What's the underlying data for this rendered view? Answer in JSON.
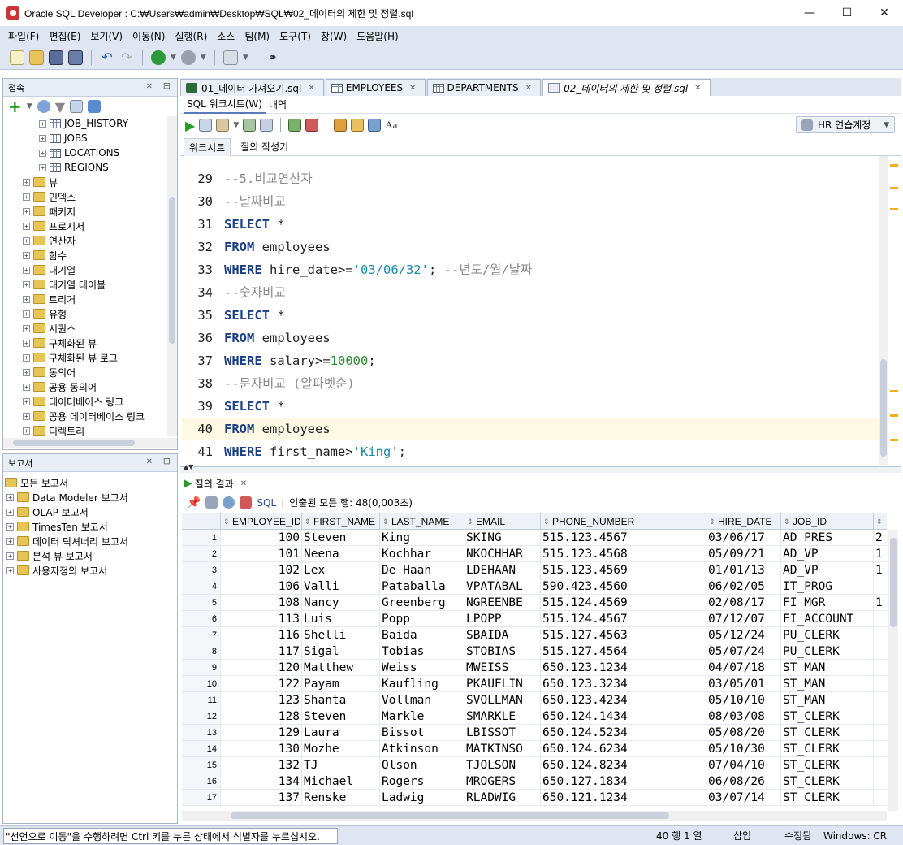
{
  "window": {
    "title": "Oracle SQL Developer : C:₩Users₩admin₩Desktop₩SQL₩02_데이터의 제한 및 정렬.sql"
  },
  "menu": [
    "파일(F)",
    "편집(E)",
    "보기(V)",
    "이동(N)",
    "실행(R)",
    "소스",
    "팀(M)",
    "도구(T)",
    "창(W)",
    "도움말(H)"
  ],
  "connections_panel": {
    "title": "접속",
    "items": [
      "JOB_HISTORY",
      "JOBS",
      "LOCATIONS",
      "REGIONS",
      "뷰",
      "인덱스",
      "패키지",
      "프로시저",
      "연산자",
      "함수",
      "대기열",
      "대기열 테이블",
      "트리거",
      "유형",
      "시퀀스",
      "구체화된 뷰",
      "구체화된 뷰 로그",
      "동의어",
      "공용 동의어",
      "데이터베이스 링크",
      "공용 데이터베이스 링크",
      "디렉토리"
    ]
  },
  "reports_panel": {
    "title": "보고서",
    "items": [
      "모든 보고서",
      "Data Modeler 보고서",
      "OLAP 보고서",
      "TimesTen 보고서",
      "데이터 딕셔너리 보고서",
      "분석 뷰 보고서",
      "사용자정의 보고서"
    ]
  },
  "editor_tabs": [
    "01_데이터 가져오기.sql",
    "EMPLOYEES",
    "DEPARTMENTS",
    "02_데이터의 제한 및 정렬.sql"
  ],
  "sub_tabs": {
    "worksheet": "SQL 워크시트(W)",
    "history": "내역"
  },
  "connection": "HR 연습계정",
  "worksheet_tabs": {
    "worksheet": "워크시트",
    "query_builder": "질의 작성기"
  },
  "code": [
    {
      "n": "29",
      "t": "--5.비교연산자"
    },
    {
      "n": "30",
      "t": "--날짜비교"
    },
    {
      "n": "31",
      "t": "SELECT *"
    },
    {
      "n": "32",
      "t": "FROM employees"
    },
    {
      "n": "33",
      "t": "WHERE hire_date>='03/06/32'; --년도/월/날짜"
    },
    {
      "n": "34",
      "t": "--숫자비교"
    },
    {
      "n": "35",
      "t": "SELECT *"
    },
    {
      "n": "36",
      "t": "FROM employees"
    },
    {
      "n": "37",
      "t": "WHERE salary>=10000;"
    },
    {
      "n": "38",
      "t": "--문자비교 (알파벳순)"
    },
    {
      "n": "39",
      "t": "SELECT *"
    },
    {
      "n": "40",
      "t": "FROM employees"
    },
    {
      "n": "41",
      "t": "WHERE first_name>'King';"
    }
  ],
  "result": {
    "tab": "질의 결과",
    "sql_label": "SQL",
    "status": "인출된 모든 행: 48(0,003초)",
    "columns": [
      "EMPLOYEE_ID",
      "FIRST_NAME",
      "LAST_NAME",
      "EMAIL",
      "PHONE_NUMBER",
      "HIRE_DATE",
      "JOB_ID",
      ""
    ],
    "rows": [
      [
        "1",
        "100",
        "Steven",
        "King",
        "SKING",
        "515.123.4567",
        "03/06/17",
        "AD_PRES",
        "2"
      ],
      [
        "2",
        "101",
        "Neena",
        "Kochhar",
        "NKOCHHAR",
        "515.123.4568",
        "05/09/21",
        "AD_VP",
        "1"
      ],
      [
        "3",
        "102",
        "Lex",
        "De Haan",
        "LDEHAAN",
        "515.123.4569",
        "01/01/13",
        "AD_VP",
        "1"
      ],
      [
        "4",
        "106",
        "Valli",
        "Pataballa",
        "VPATABAL",
        "590.423.4560",
        "06/02/05",
        "IT_PROG",
        ""
      ],
      [
        "5",
        "108",
        "Nancy",
        "Greenberg",
        "NGREENBE",
        "515.124.4569",
        "02/08/17",
        "FI_MGR",
        "1"
      ],
      [
        "6",
        "113",
        "Luis",
        "Popp",
        "LPOPP",
        "515.124.4567",
        "07/12/07",
        "FI_ACCOUNT",
        ""
      ],
      [
        "7",
        "116",
        "Shelli",
        "Baida",
        "SBAIDA",
        "515.127.4563",
        "05/12/24",
        "PU_CLERK",
        ""
      ],
      [
        "8",
        "117",
        "Sigal",
        "Tobias",
        "STOBIAS",
        "515.127.4564",
        "05/07/24",
        "PU_CLERK",
        ""
      ],
      [
        "9",
        "120",
        "Matthew",
        "Weiss",
        "MWEISS",
        "650.123.1234",
        "04/07/18",
        "ST_MAN",
        ""
      ],
      [
        "10",
        "122",
        "Payam",
        "Kaufling",
        "PKAUFLIN",
        "650.123.3234",
        "03/05/01",
        "ST_MAN",
        ""
      ],
      [
        "11",
        "123",
        "Shanta",
        "Vollman",
        "SVOLLMAN",
        "650.123.4234",
        "05/10/10",
        "ST_MAN",
        ""
      ],
      [
        "12",
        "128",
        "Steven",
        "Markle",
        "SMARKLE",
        "650.124.1434",
        "08/03/08",
        "ST_CLERK",
        ""
      ],
      [
        "13",
        "129",
        "Laura",
        "Bissot",
        "LBISSOT",
        "650.124.5234",
        "05/08/20",
        "ST_CLERK",
        ""
      ],
      [
        "14",
        "130",
        "Mozhe",
        "Atkinson",
        "MATKINSO",
        "650.124.6234",
        "05/10/30",
        "ST_CLERK",
        ""
      ],
      [
        "15",
        "132",
        "TJ",
        "Olson",
        "TJOLSON",
        "650.124.8234",
        "07/04/10",
        "ST_CLERK",
        ""
      ],
      [
        "16",
        "134",
        "Michael",
        "Rogers",
        "MROGERS",
        "650.127.1834",
        "06/08/26",
        "ST_CLERK",
        ""
      ],
      [
        "17",
        "137",
        "Renske",
        "Ladwig",
        "RLADWIG",
        "650.121.1234",
        "03/07/14",
        "ST_CLERK",
        ""
      ]
    ]
  },
  "statusbar": {
    "message": "\"선언으로 이동\"을 수행하려면 Ctrl 키를 누른 상태에서 식별자를 누르십시오.",
    "position": "40 행 1 열",
    "mode": "삽입",
    "modified": "수정됨",
    "eol": "Windows: CR"
  },
  "colors": {
    "chrome": "#dfe6f2",
    "keyword": "#1d3f86",
    "string": "#1a8aa8",
    "comment": "#8a8a8a",
    "number": "#2b8a2b"
  }
}
